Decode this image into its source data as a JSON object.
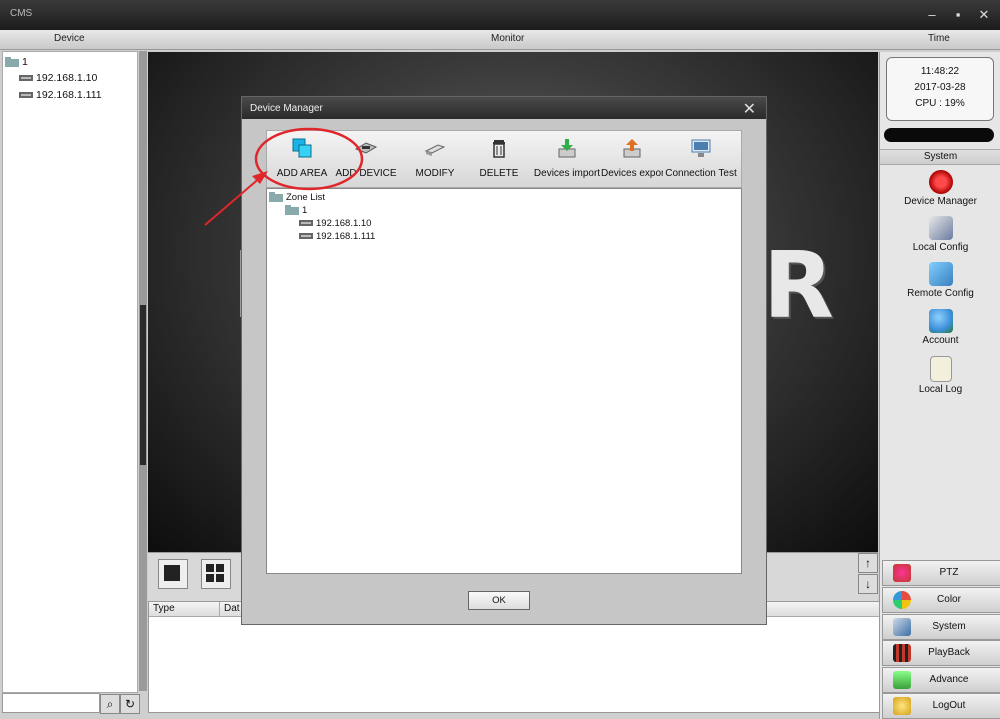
{
  "window": {
    "title": "CMS",
    "minimize": "–",
    "maximize": "▪",
    "close": "✕"
  },
  "header": {
    "device": "Device",
    "monitor": "Monitor",
    "time": "Time"
  },
  "device_tree": {
    "root": "1",
    "devices": [
      "192.168.1.10",
      "192.168.1.111"
    ]
  },
  "monitor": {
    "letter_left": "I",
    "letter_right": "R"
  },
  "log_table": {
    "columns": [
      "Type",
      "Dat"
    ]
  },
  "clock": {
    "time": "11:48:22",
    "date": "2017-03-28",
    "cpu": "CPU : 19%"
  },
  "system_panel": {
    "header": "System",
    "items": [
      {
        "label": "Device Manager",
        "icon": "record-icon",
        "color": "#d01010"
      },
      {
        "label": "Local Config",
        "icon": "local-config-icon",
        "color": "#6a7ca0"
      },
      {
        "label": "Remote Config",
        "icon": "remote-config-icon",
        "color": "#3a7fbf"
      },
      {
        "label": "Account",
        "icon": "account-icon",
        "color": "#3b8fd8"
      },
      {
        "label": "Local Log",
        "icon": "log-icon",
        "color": "#f2f0dc"
      }
    ]
  },
  "bottom_menu": [
    {
      "label": "PTZ",
      "icon": "ptz-icon",
      "color": "#c0392b"
    },
    {
      "label": "Color",
      "icon": "color-icon",
      "color": "#e67e22"
    },
    {
      "label": "System",
      "icon": "system-icon",
      "color": "#3a6fa5"
    },
    {
      "label": "PlayBack",
      "icon": "playback-icon",
      "color": "#c0392b"
    },
    {
      "label": "Advance",
      "icon": "advance-icon",
      "color": "#3aa03a"
    },
    {
      "label": "LogOut",
      "icon": "logout-icon",
      "color": "#d4a017"
    }
  ],
  "dialog": {
    "title": "Device Manager",
    "close": "✕",
    "toolbar": [
      {
        "label": "ADD AREA",
        "icon": "add-area-icon",
        "color": "#18b4e6"
      },
      {
        "label": "ADD DEVICE",
        "icon": "add-device-icon",
        "color": "#8a8a8a"
      },
      {
        "label": "MODIFY",
        "icon": "modify-icon",
        "color": "#8a8a8a"
      },
      {
        "label": "DELETE",
        "icon": "trash-icon",
        "color": "#444444"
      },
      {
        "label": "Devices import",
        "icon": "import-icon",
        "color": "#2fae4a"
      },
      {
        "label": "Devices expor",
        "icon": "export-icon",
        "color": "#e07020"
      },
      {
        "label": "Connection  Test",
        "icon": "connection-test-icon",
        "color": "#4a7fb0"
      }
    ],
    "zone_list": {
      "root": "Zone List",
      "area": "1",
      "devices": [
        "192.168.1.10",
        "192.168.1.111"
      ]
    },
    "ok": "OK"
  },
  "annotation": {
    "color": "#e0262a"
  }
}
